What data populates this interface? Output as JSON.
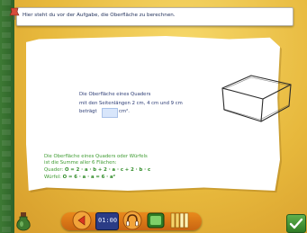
{
  "instruction": "Hier steht du vor der Aufgabe, die Oberfläche zu berechnen.",
  "task": {
    "line1": "Die Oberfläche eines Quaders",
    "line2": "mit den Seitenlängen 2 cm, 4 cm und 9 cm",
    "prefix": "beträgt",
    "answer_value": "",
    "unit": "cm²."
  },
  "note": {
    "line1": "Die Oberfläche eines Quaders oder Würfels",
    "line2": "ist die Summe aller 6 Flächen:",
    "quader_label": "Quader:",
    "quader_formula": "O = 2 · a · b + 2 · a · c + 2 · b · c",
    "wuerfel_label": "Würfel:",
    "wuerfel_formula": "O = 6 · a · a = 6 · a²"
  },
  "toolbar": {
    "clock_text": "01:00"
  },
  "icons": [
    "pin-icon",
    "back-arrow-icon",
    "clock-icon",
    "help-icon",
    "display-icon",
    "progress-icon",
    "check-icon",
    "potion-icon"
  ],
  "colors": {
    "text_blue": "#2a3a73",
    "note_green": "#3c9a2f",
    "toolbar_orange": "#e98a1c",
    "background_yellow": "#e7b83c"
  }
}
